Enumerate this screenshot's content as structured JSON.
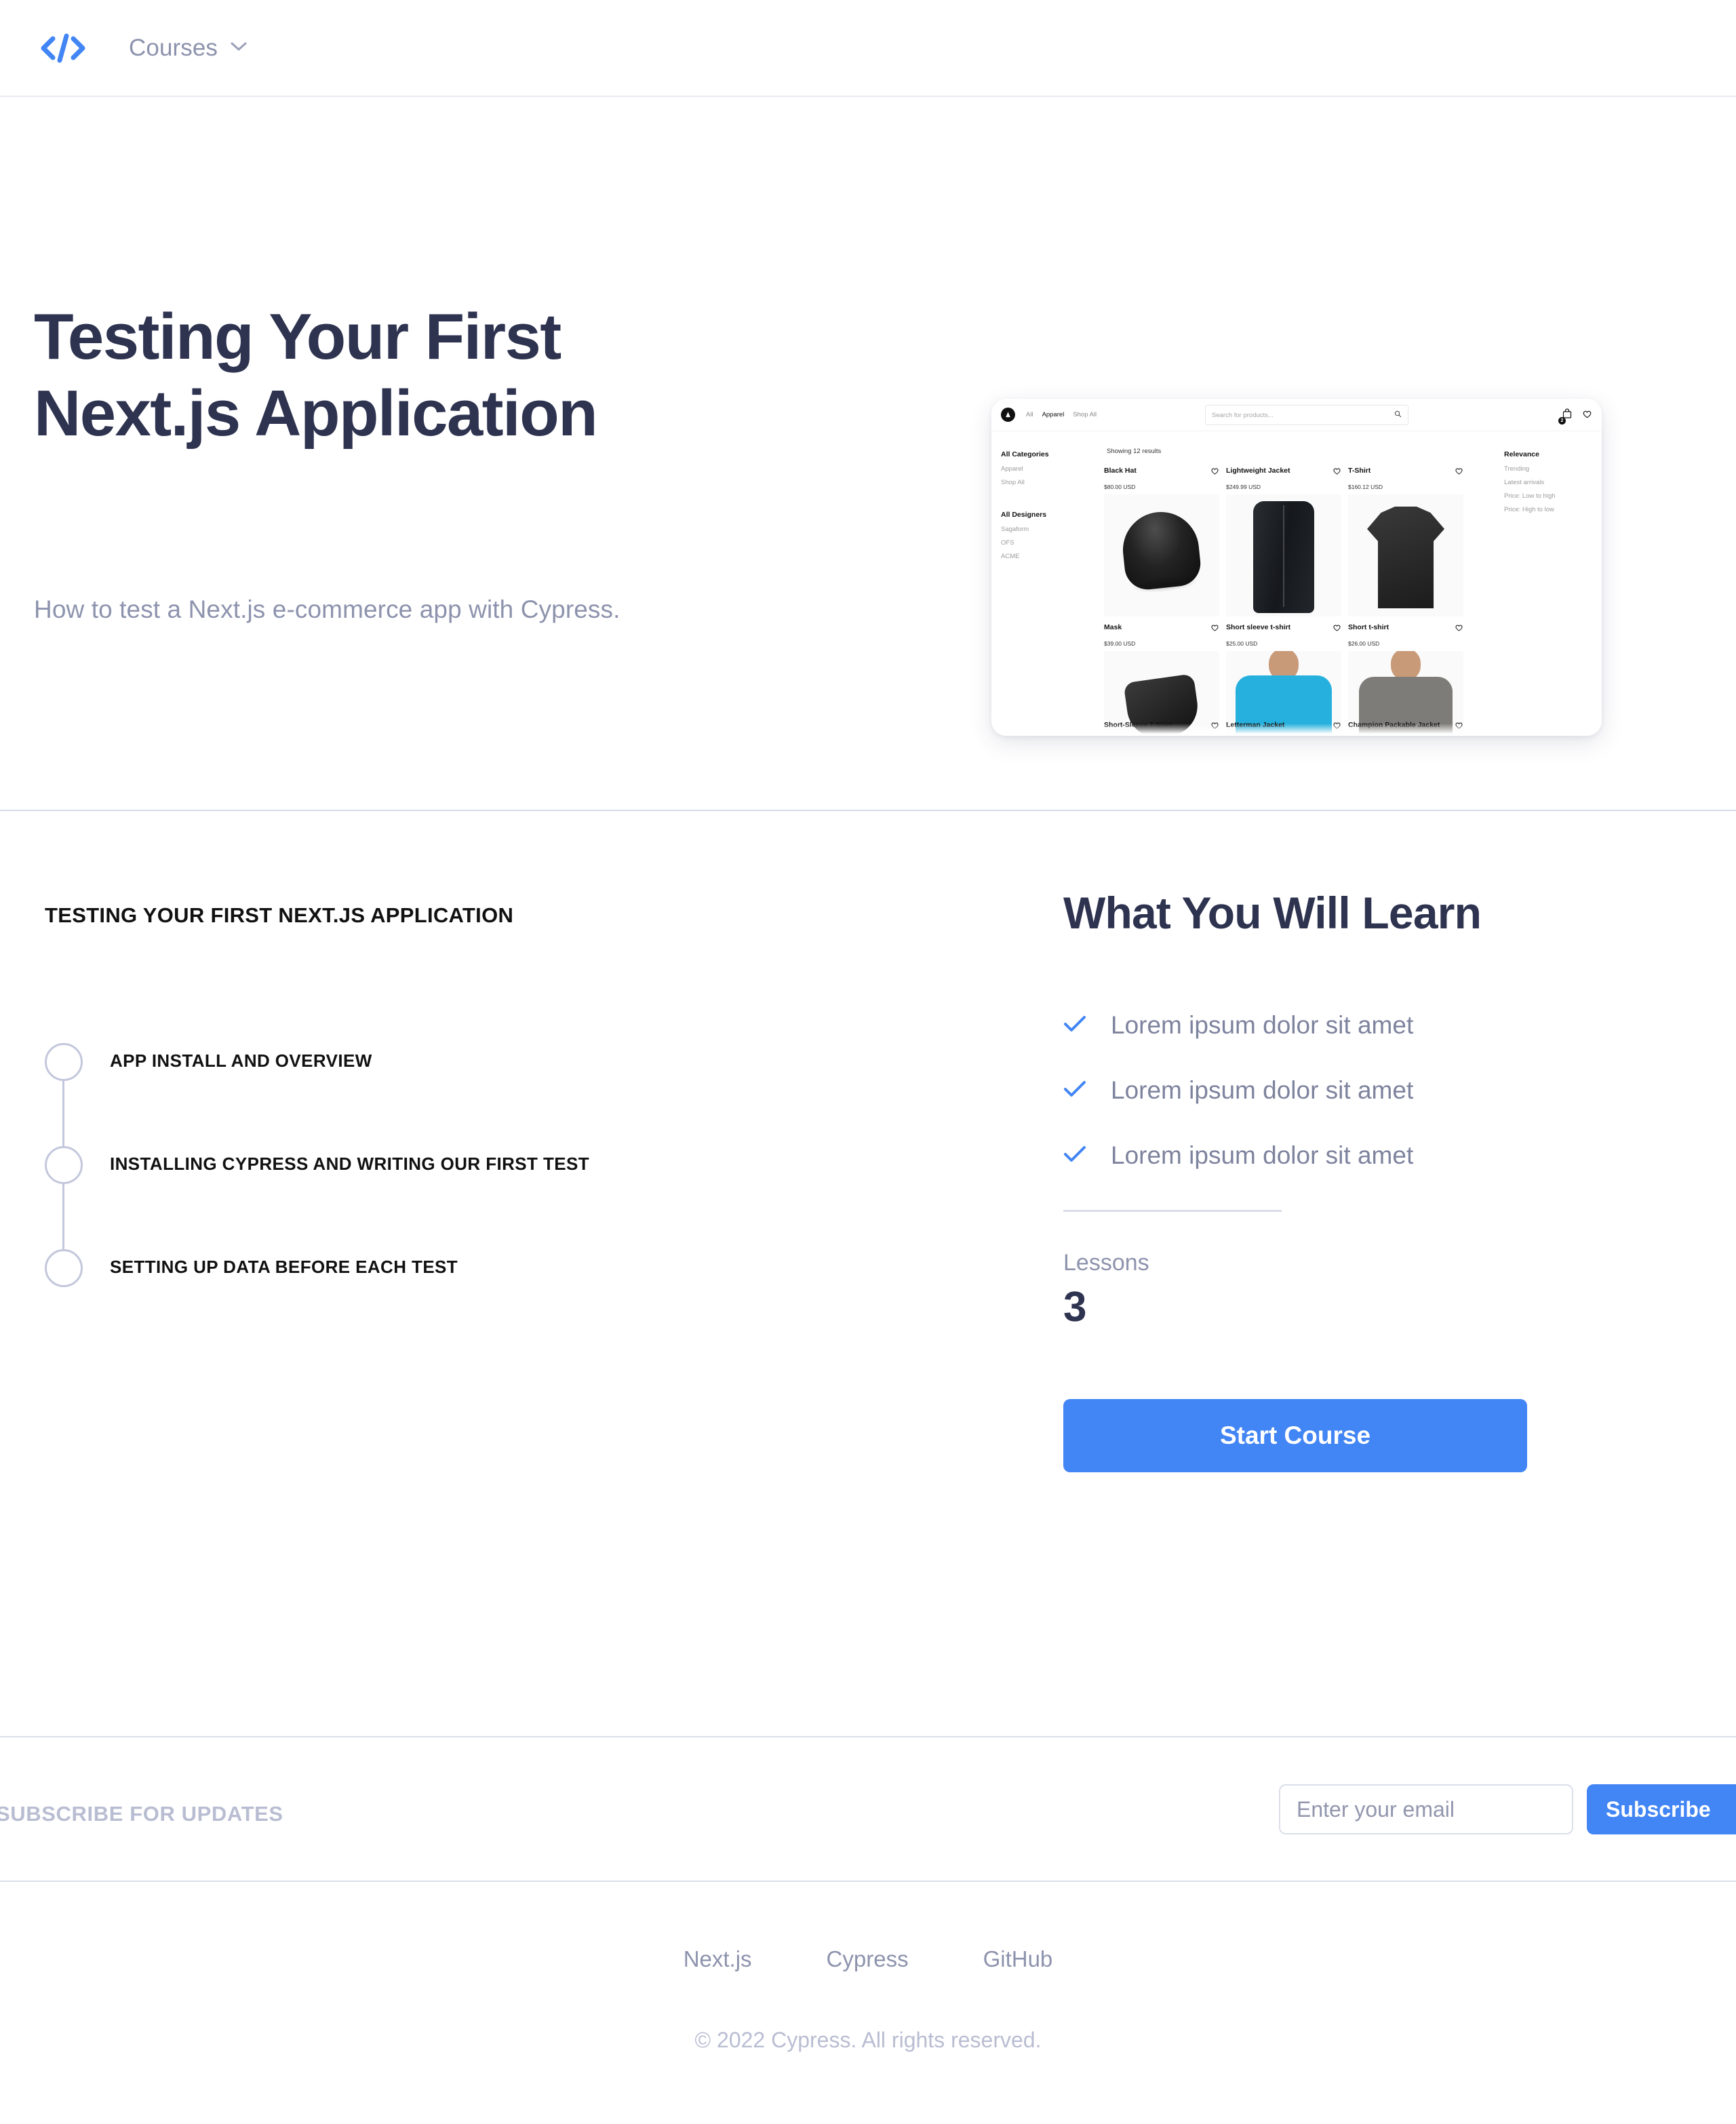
{
  "header": {
    "logo_icon": "code-brackets-icon",
    "nav": {
      "courses_label": "Courses",
      "chevron_icon": "chevron-down-icon"
    },
    "accent_color": "#4285f4"
  },
  "hero": {
    "title_line1": "Testing Your First",
    "title_line2": "Next.js Application",
    "subtitle": "How to test a Next.js e-commerce app with Cypress.",
    "title_color": "#2e3350",
    "subtitle_color": "#8d93ad"
  },
  "hero_image": {
    "alt": "Next.js e-commerce demo store screenshot",
    "topnav": {
      "logo": "A",
      "links": [
        "All",
        "Apparel",
        "Shop All"
      ]
    },
    "search_placeholder": "Search for products...",
    "search_icon": "search-icon",
    "cart_icon": "cart-icon",
    "cart_count": "2",
    "wishlist_icon": "heart-icon",
    "results_text": "Showing 12 results",
    "categories_title": "All Categories",
    "categories": [
      "Apparel",
      "Shop All"
    ],
    "designers_title": "All Designers",
    "designers": [
      "Sagaform",
      "OFS",
      "ACME"
    ],
    "sort_title": "Relevance",
    "sort_options": [
      "Trending",
      "Latest arrivals",
      "Price: Low to high",
      "Price: High to low"
    ],
    "products_row1": [
      {
        "name": "Black Hat",
        "price": "$80.00 USD"
      },
      {
        "name": "Lightweight Jacket",
        "price": "$249.99 USD"
      },
      {
        "name": "T-Shirt",
        "price": "$160.12 USD"
      }
    ],
    "products_row2": [
      {
        "name": "Mask",
        "price": "$39.00 USD"
      },
      {
        "name": "Short sleeve t-shirt",
        "price": "$25.00 USD"
      },
      {
        "name": "Short t-shirt",
        "price": "$26.00 USD"
      }
    ],
    "products_row3": [
      {
        "name": "Short-Sleeve T-Shirt"
      },
      {
        "name": "Letterman Jacket"
      },
      {
        "name": "Champion Packable Jacket"
      }
    ]
  },
  "curriculum": {
    "kicker": "TESTING YOUR FIRST NEXT.JS APPLICATION",
    "lessons": [
      {
        "label": "APP INSTALL AND OVERVIEW"
      },
      {
        "label": "INSTALLING CYPRESS AND WRITING OUR FIRST TEST"
      },
      {
        "label": "SETTING UP DATA BEFORE EACH TEST"
      }
    ]
  },
  "learn": {
    "title": "What You Will Learn",
    "check_icon": "check-icon",
    "items": [
      "Lorem ipsum dolor sit amet",
      "Lorem ipsum dolor sit amet",
      "Lorem ipsum dolor sit amet"
    ],
    "lessons_label": "Lessons",
    "lessons_count": "3",
    "start_button": "Start Course"
  },
  "footer": {
    "subscribe_label": "SUBSCRIBE FOR UPDATES",
    "email_placeholder": "Enter your email",
    "email_value": "",
    "subscribe_button": "Subscribe",
    "links": [
      "Next.js",
      "Cypress",
      "GitHub"
    ],
    "copyright": "© 2022 Cypress. All rights reserved."
  }
}
